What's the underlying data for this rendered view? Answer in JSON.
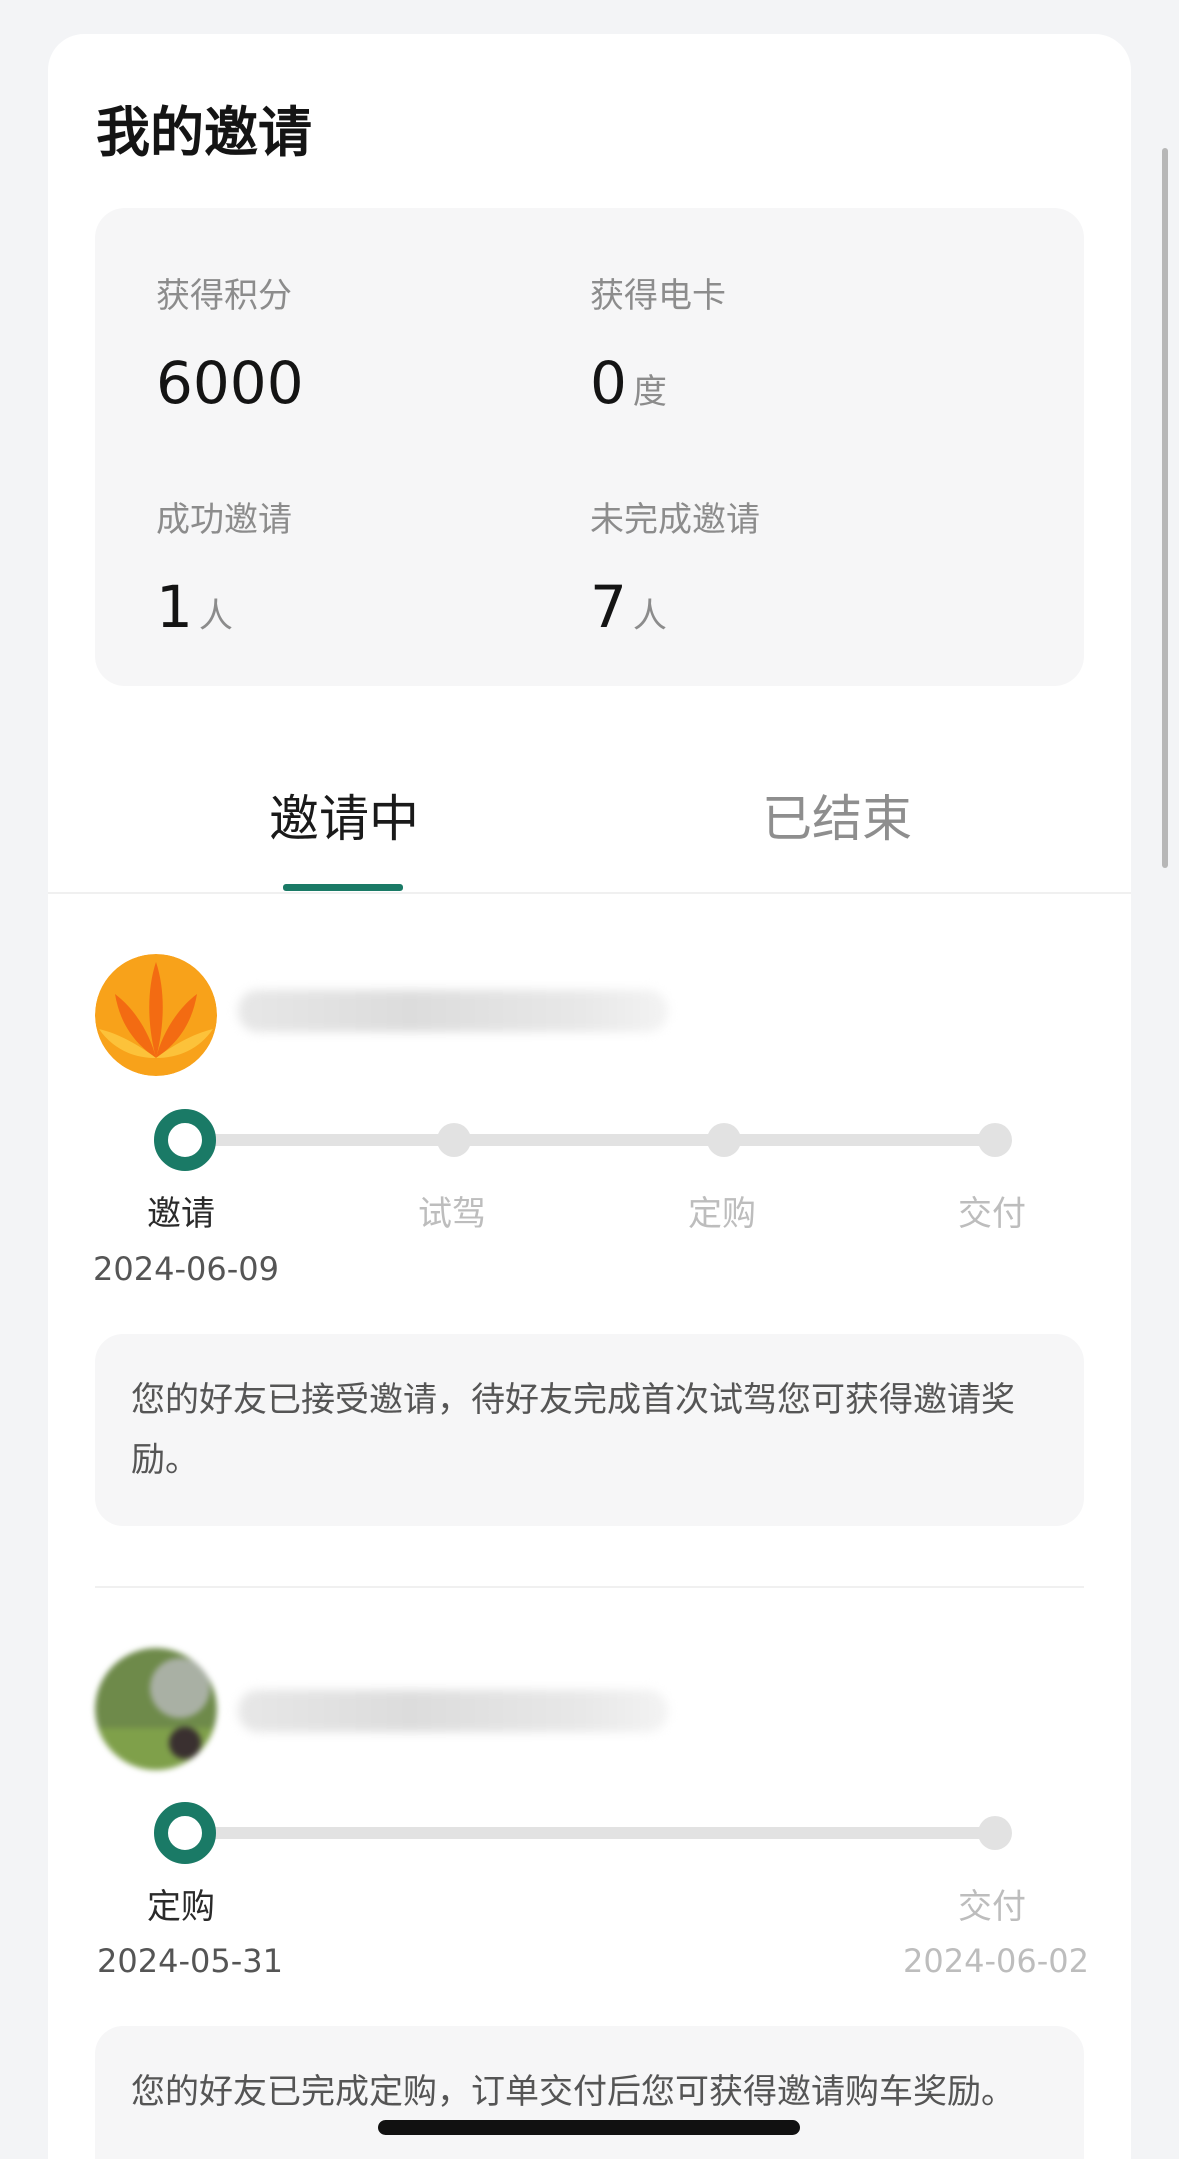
{
  "header": {
    "title": "我的邀请"
  },
  "stats": [
    {
      "label": "获得积分",
      "value": "6000",
      "unit": ""
    },
    {
      "label": "获得电卡",
      "value": "0",
      "unit": "度"
    },
    {
      "label": "成功邀请",
      "value": "1",
      "unit": "人"
    },
    {
      "label": "未完成邀请",
      "value": "7",
      "unit": "人"
    }
  ],
  "tabs": [
    {
      "label": "邀请中",
      "active": true
    },
    {
      "label": "已结束",
      "active": false
    }
  ],
  "invites": [
    {
      "steps": [
        {
          "label": "邀请",
          "date": "2024-06-09",
          "done": true
        },
        {
          "label": "试驾",
          "date": "",
          "done": false
        },
        {
          "label": "定购",
          "date": "",
          "done": false
        },
        {
          "label": "交付",
          "date": "",
          "done": false
        }
      ],
      "message": "您的好友已接受邀请，待好友完成首次试驾您可获得邀请奖励。"
    },
    {
      "steps": [
        {
          "label": "定购",
          "date": "2024-05-31",
          "done": true
        },
        {
          "label": "交付",
          "date": "2024-06-02",
          "done": false
        }
      ],
      "message": "您的好友已完成定购，订单交付后您可获得邀请购车奖励。"
    }
  ],
  "colors": {
    "accent": "#1a7a66",
    "background": "#f3f4f6",
    "panel": "#f6f6f7"
  }
}
